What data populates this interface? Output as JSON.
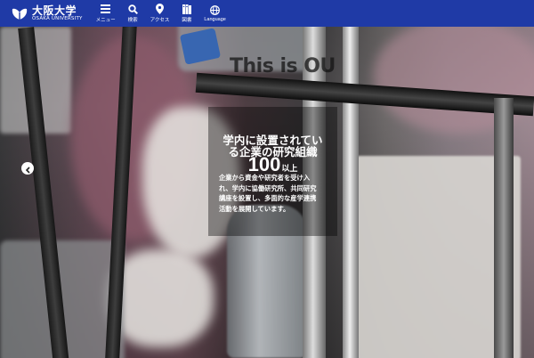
{
  "header": {
    "logo": {
      "name_ja": "大阪大学",
      "name_en": "OSAKA UNIVERSITY"
    },
    "nav": [
      {
        "icon": "menu-icon",
        "label": "メニュー"
      },
      {
        "icon": "search-icon",
        "label": "検索"
      },
      {
        "icon": "location-pin-icon",
        "label": "アクセス"
      },
      {
        "icon": "library-icon",
        "label": "図書"
      },
      {
        "icon": "globe-icon",
        "label": "Language"
      }
    ]
  },
  "slide": {
    "prev_arrow_icon": "chevron-left-icon",
    "overlay_word": "This is OU",
    "title_lines": [
      "学内に設置されてい",
      "る企業の研究組織"
    ],
    "number": "100",
    "unit": "以上",
    "body_lines": [
      "企業から資金や研究者を受け入",
      "れ、学内に協働研究所、共同研究",
      "講座を設置し、多面的な産学連携",
      "活動を展開しています。"
    ]
  },
  "colors": {
    "header_bg": "#1f3aa6",
    "text": "#ffffff"
  }
}
